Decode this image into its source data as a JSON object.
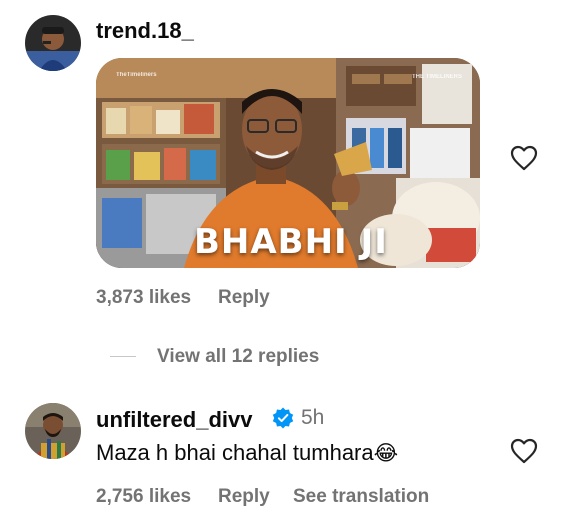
{
  "comments": [
    {
      "username": "trend.18_",
      "gif": {
        "caption": "BHABHI JI",
        "watermark_left": "TheTimeliners",
        "watermark_right": "THE TIMELINERS"
      },
      "likes": "3,873 likes",
      "reply_label": "Reply",
      "view_replies": "View all 12 replies"
    },
    {
      "username": "unfiltered_divv",
      "verified": true,
      "time": "5h",
      "text": "Maza h bhai chahal tumhara",
      "emoji": "😂",
      "likes": "2,756 likes",
      "reply_label": "Reply",
      "translate_label": "See translation"
    }
  ],
  "colors": {
    "meta": "#737373",
    "verified": "#0095f6",
    "gif_orange": "#e07a2c"
  }
}
